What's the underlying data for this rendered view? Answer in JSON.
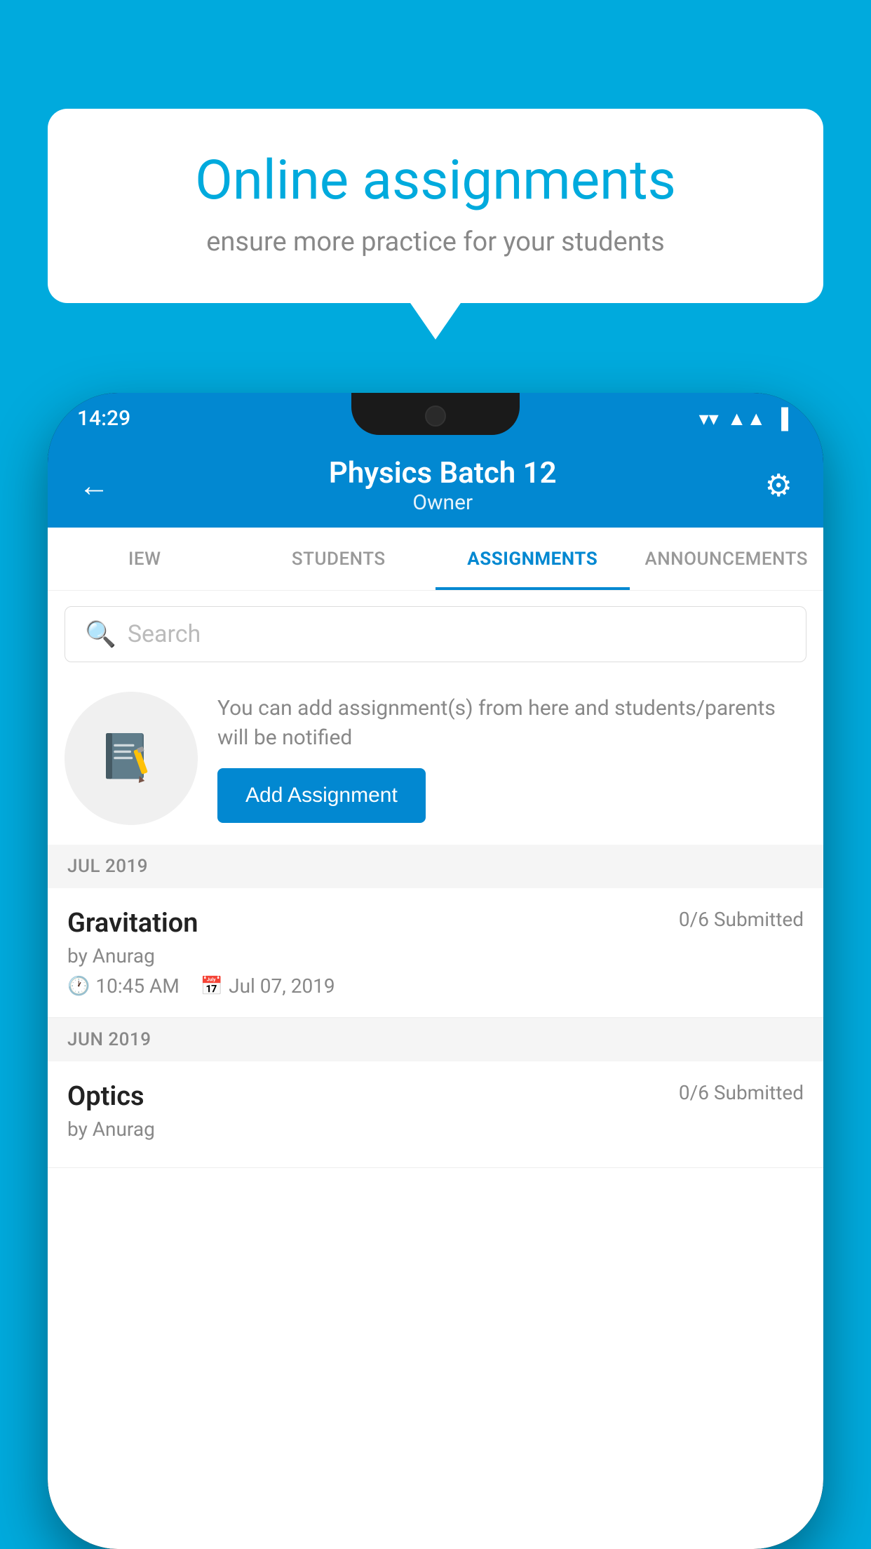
{
  "background_color": "#00AADD",
  "speech_bubble": {
    "title": "Online assignments",
    "subtitle": "ensure more practice for your students"
  },
  "phone": {
    "status_bar": {
      "time": "14:29",
      "wifi": "▼",
      "signal": "▲",
      "battery": "▌"
    },
    "header": {
      "title": "Physics Batch 12",
      "subtitle": "Owner",
      "back_label": "←",
      "settings_label": "⚙"
    },
    "tabs": [
      {
        "label": "IEW",
        "active": false
      },
      {
        "label": "STUDENTS",
        "active": false
      },
      {
        "label": "ASSIGNMENTS",
        "active": true
      },
      {
        "label": "ANNOUNCEMENTS",
        "active": false
      }
    ],
    "search": {
      "placeholder": "Search"
    },
    "info_section": {
      "text": "You can add assignment(s) from here and students/parents will be notified",
      "button_label": "Add Assignment"
    },
    "sections": [
      {
        "header": "JUL 2019",
        "assignments": [
          {
            "name": "Gravitation",
            "submitted": "0/6 Submitted",
            "by": "by Anurag",
            "time": "10:45 AM",
            "date": "Jul 07, 2019"
          }
        ]
      },
      {
        "header": "JUN 2019",
        "assignments": [
          {
            "name": "Optics",
            "submitted": "0/6 Submitted",
            "by": "by Anurag",
            "time": "",
            "date": ""
          }
        ]
      }
    ]
  }
}
